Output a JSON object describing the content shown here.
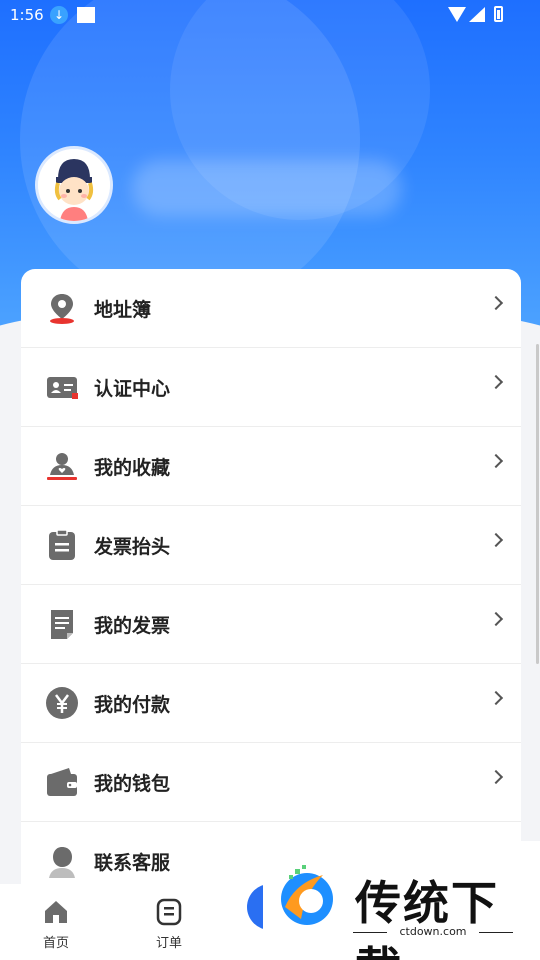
{
  "status_bar": {
    "time": "1:56"
  },
  "menu": [
    {
      "id": "address",
      "label": "地址簿",
      "icon": "location-pin-icon"
    },
    {
      "id": "verify",
      "label": "认证中心",
      "icon": "id-card-icon"
    },
    {
      "id": "favorites",
      "label": "我的收藏",
      "icon": "favorite-person-icon"
    },
    {
      "id": "invoice-title",
      "label": "发票抬头",
      "icon": "clipboard-icon"
    },
    {
      "id": "my-invoice",
      "label": "我的发票",
      "icon": "document-icon"
    },
    {
      "id": "payments",
      "label": "我的付款",
      "icon": "yen-icon"
    },
    {
      "id": "wallet",
      "label": "我的钱包",
      "icon": "wallet-icon"
    },
    {
      "id": "support",
      "label": "联系客服",
      "icon": "customer-service-icon"
    }
  ],
  "tabbar": {
    "home": "首页",
    "orders": "订单"
  },
  "watermark": {
    "title": "传统下载",
    "url": "ctdown.com"
  },
  "colors": {
    "accent": "#1e6fff",
    "icon_gray": "#6b6b6b",
    "icon_red": "#e8342f"
  }
}
